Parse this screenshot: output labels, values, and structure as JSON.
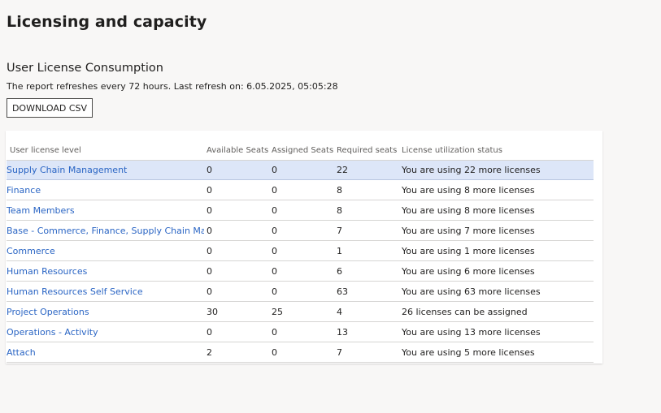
{
  "page": {
    "title": "Licensing and capacity",
    "section_title": "User License Consumption",
    "refresh_note": "The report refreshes every 72 hours. Last refresh on: 6.05.2025, 05:05:28",
    "download_label": "DOWNLOAD CSV"
  },
  "table": {
    "headers": [
      "User license level",
      "Available Seats",
      "Assigned Seats",
      "Required seats",
      "License utilization status"
    ],
    "rows": [
      {
        "level": "Supply Chain Management",
        "available": "0",
        "assigned": "0",
        "required": "22",
        "status": "You are using 22 more licenses"
      },
      {
        "level": "Finance",
        "available": "0",
        "assigned": "0",
        "required": "8",
        "status": "You are using 8 more licenses"
      },
      {
        "level": "Team Members",
        "available": "0",
        "assigned": "0",
        "required": "8",
        "status": "You are using 8 more licenses"
      },
      {
        "level": "Base - Commerce, Finance, Supply Chain Manage",
        "available": "0",
        "assigned": "0",
        "required": "7",
        "status": "You are using 7 more licenses"
      },
      {
        "level": "Commerce",
        "available": "0",
        "assigned": "0",
        "required": "1",
        "status": "You are using 1 more licenses"
      },
      {
        "level": "Human Resources",
        "available": "0",
        "assigned": "0",
        "required": "6",
        "status": "You are using 6 more licenses"
      },
      {
        "level": "Human Resources Self Service",
        "available": "0",
        "assigned": "0",
        "required": "63",
        "status": "You are using 63 more licenses"
      },
      {
        "level": "Project Operations",
        "available": "30",
        "assigned": "25",
        "required": "4",
        "status": "26 licenses can be assigned"
      },
      {
        "level": "Operations - Activity",
        "available": "0",
        "assigned": "0",
        "required": "13",
        "status": "You are using 13 more licenses"
      },
      {
        "level": "Attach",
        "available": "2",
        "assigned": "0",
        "required": "7",
        "status": "You are using 5 more licenses"
      }
    ],
    "selected_row": 0
  },
  "colors": {
    "link": "#2a65c4",
    "selected_row": "#dde6f8",
    "background": "#f8f7f6"
  }
}
